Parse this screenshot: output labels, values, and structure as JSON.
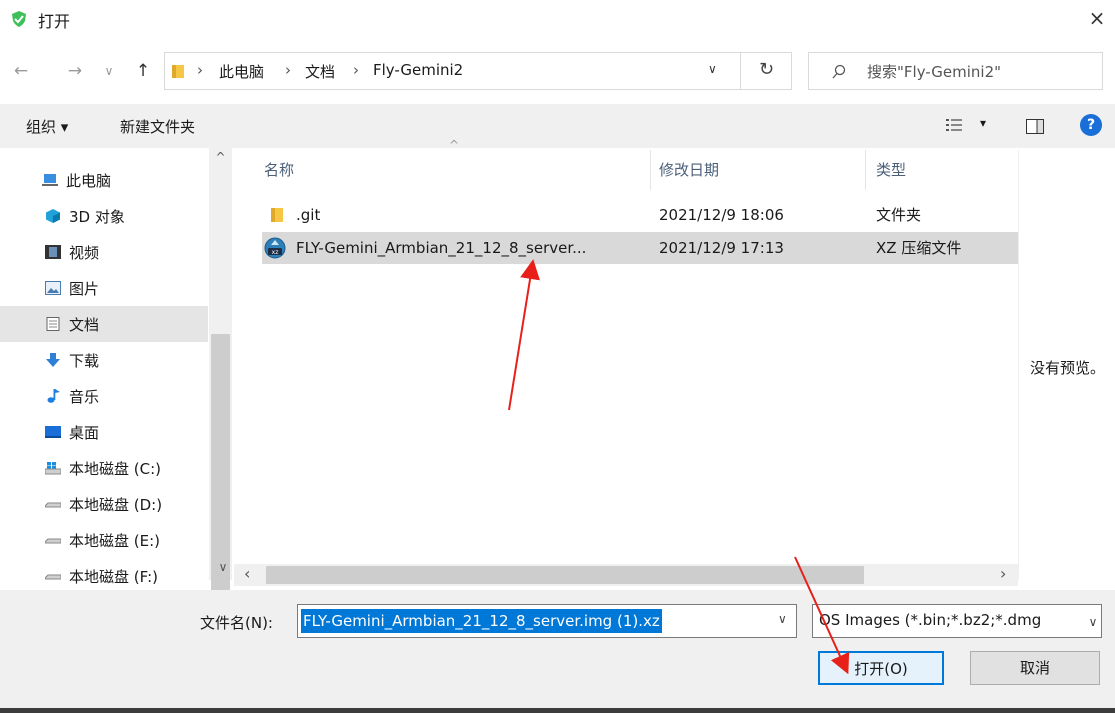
{
  "window": {
    "title": "打开",
    "close_glyph": "×"
  },
  "nav": {
    "back_glyph": "←",
    "forward_glyph": "→",
    "recent_glyph": "∨",
    "up_glyph": "↑",
    "breadcrumb": [
      "此电脑",
      "文档",
      "Fly-Gemini2"
    ],
    "separator": "›",
    "dropdown_glyph": "∨",
    "refresh_glyph": "↻",
    "search_placeholder": "搜索\"Fly-Gemini2\""
  },
  "toolbar": {
    "organize_label": "组织 ▾",
    "new_folder_label": "新建文件夹",
    "view_dropdown": "▾",
    "help_glyph": "?"
  },
  "sidebar": {
    "items": [
      {
        "label": "此电脑",
        "icon": "computer-icon"
      },
      {
        "label": "3D 对象",
        "icon": "cube-icon"
      },
      {
        "label": "视频",
        "icon": "film-icon"
      },
      {
        "label": "图片",
        "icon": "picture-icon"
      },
      {
        "label": "文档",
        "icon": "document-icon",
        "selected": true
      },
      {
        "label": "下载",
        "icon": "download-icon"
      },
      {
        "label": "音乐",
        "icon": "music-icon"
      },
      {
        "label": "桌面",
        "icon": "desktop-icon"
      },
      {
        "label": "本地磁盘 (C:)",
        "icon": "windows-drive-icon"
      },
      {
        "label": "本地磁盘 (D:)",
        "icon": "drive-icon"
      },
      {
        "label": "本地磁盘 (E:)",
        "icon": "drive-icon"
      },
      {
        "label": "本地磁盘 (F:)",
        "icon": "drive-icon"
      }
    ]
  },
  "file_list": {
    "columns": [
      "名称",
      "修改日期",
      "类型"
    ],
    "sort_glyph": "^",
    "rows": [
      {
        "name": ".git",
        "date": "2021/12/9 18:06",
        "type": "文件夹",
        "icon": "folder-icon",
        "selected": false
      },
      {
        "name": "FLY-Gemini_Armbian_21_12_8_server...",
        "date": "2021/12/9 17:13",
        "type": "XZ 压缩文件",
        "icon": "xz-archive-icon",
        "selected": true
      }
    ],
    "hscroll_left": "‹",
    "hscroll_right": "›",
    "vscroll_up": "^",
    "vscroll_down": "∨"
  },
  "preview": {
    "empty_text": "没有预览。"
  },
  "footer": {
    "filename_label": "文件名(N):",
    "filename_value": "FLY-Gemini_Armbian_21_12_8_server.img (1).xz",
    "filetype_value": "OS Images (*.bin;*.bz2;*.dmg",
    "dropdown_glyph": "∨",
    "open_label": "打开(O)",
    "cancel_label": "取消"
  },
  "colors": {
    "accent": "#0078d7",
    "selection_gray": "#d9d9d9",
    "toolbar_bg": "#f0f0f0",
    "annotation_red": "#e8201a",
    "header_text": "#4c607a"
  }
}
